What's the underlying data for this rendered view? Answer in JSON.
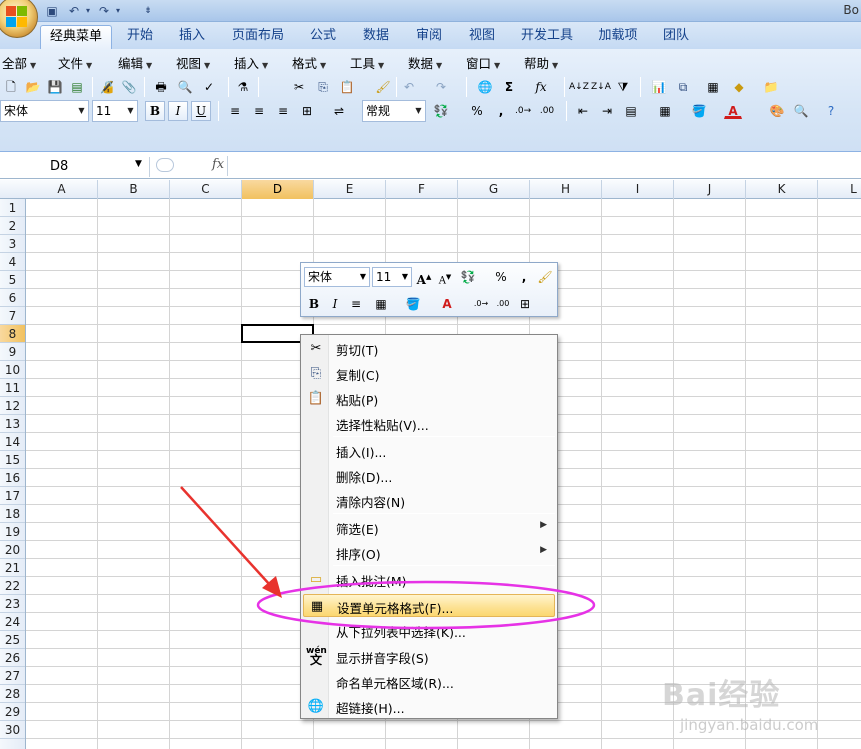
{
  "window": {
    "title_partial": "Bo"
  },
  "tabs": [
    {
      "label": "经典菜单",
      "active": true
    },
    {
      "label": "开始"
    },
    {
      "label": "插入"
    },
    {
      "label": "页面布局"
    },
    {
      "label": "公式"
    },
    {
      "label": "数据"
    },
    {
      "label": "审阅"
    },
    {
      "label": "视图"
    },
    {
      "label": "开发工具"
    },
    {
      "label": "加载项"
    },
    {
      "label": "团队"
    }
  ],
  "classic_menu": [
    {
      "label": "全部"
    },
    {
      "label": "文件"
    },
    {
      "label": "编辑"
    },
    {
      "label": "视图"
    },
    {
      "label": "插入"
    },
    {
      "label": "格式"
    },
    {
      "label": "工具"
    },
    {
      "label": "数据"
    },
    {
      "label": "窗口"
    },
    {
      "label": "帮助"
    }
  ],
  "format_toolbar": {
    "font_name": "宋体",
    "font_size": "11",
    "bold": "B",
    "italic": "I",
    "underline": "U",
    "number_format": "常规",
    "percent": "%",
    "comma": ","
  },
  "formula_bar": {
    "name_box": "D8",
    "fx": "fx",
    "formula": ""
  },
  "columns": [
    "A",
    "B",
    "C",
    "D",
    "E",
    "F",
    "G",
    "H",
    "I",
    "J",
    "K",
    "L"
  ],
  "selected_column": "D",
  "rows": [
    "1",
    "2",
    "3",
    "4",
    "5",
    "6",
    "7",
    "8",
    "9",
    "10",
    "11",
    "12",
    "13",
    "14",
    "15",
    "16",
    "17",
    "18",
    "19",
    "20",
    "21",
    "22",
    "23",
    "24",
    "25",
    "26",
    "27",
    "28",
    "29",
    "30"
  ],
  "selected_row": "8",
  "mini_toolbar": {
    "font_name": "宋体",
    "font_size": "11",
    "percent": "%",
    "comma": ",",
    "bold": "B",
    "italic": "I"
  },
  "context_menu": {
    "items": [
      {
        "label": "剪切(T)",
        "icon": "scissors-icon"
      },
      {
        "label": "复制(C)",
        "icon": "copy-icon"
      },
      {
        "label": "粘贴(P)",
        "icon": "paste-icon"
      },
      {
        "label": "选择性粘贴(V)..."
      },
      {
        "label": "插入(I)..."
      },
      {
        "label": "删除(D)..."
      },
      {
        "label": "清除内容(N)"
      },
      {
        "label": "筛选(E)",
        "submenu": true
      },
      {
        "label": "排序(O)",
        "submenu": true
      },
      {
        "label": "插入批注(M)",
        "icon": "comment-icon"
      },
      {
        "label": "设置单元格格式(F)...",
        "icon": "format-cells-icon",
        "highlighted": true
      },
      {
        "label": "从下拉列表中选择(K)..."
      },
      {
        "label": "显示拼音字段(S)",
        "icon": "pinyin-icon"
      },
      {
        "label": "命名单元格区域(R)..."
      },
      {
        "label": "超链接(H)...",
        "icon": "hyperlink-icon"
      }
    ],
    "pinyin_icon_text": "wén"
  },
  "watermark": {
    "brand": "Bai经验",
    "url": "jingyan.baidu.com"
  },
  "colors": {
    "ribbon": "#d6e5f6",
    "selected_header": "#f1c15f",
    "highlight": "#fbd770",
    "annotation_ellipse": "#e632e6",
    "annotation_arrow": "#e8332e"
  }
}
